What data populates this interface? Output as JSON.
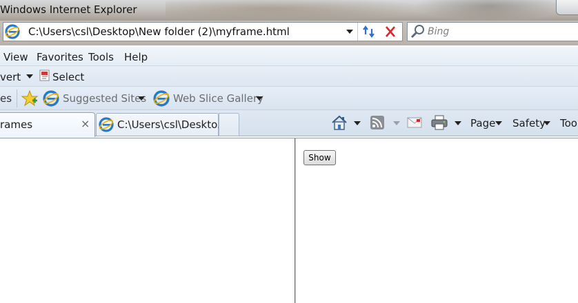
{
  "window": {
    "title": "Windows Internet Explorer"
  },
  "address_bar": {
    "url": "C:\\Users\\csl\\Desktop\\New folder (2)\\myframe.html",
    "search_placeholder": "Bing"
  },
  "menu_bar": {
    "items": [
      "View",
      "Favorites",
      "Tools",
      "Help"
    ]
  },
  "command_row": {
    "convert_label": "vert",
    "select_label": "Select"
  },
  "favorites_bar": {
    "cut_label": "es",
    "suggested_sites": "Suggested Sites",
    "web_slice_gallery": "Web Slice Gallery"
  },
  "tabs": {
    "active_label": "rames",
    "close_glyph": "×",
    "second_label": "C:\\Users\\csl\\Deskto..."
  },
  "command_bar": {
    "page": "Page",
    "safety": "Safety",
    "tools": "Too"
  },
  "content": {
    "show_button": "Show"
  },
  "colors": {
    "toolbar_blue": "#dfe8f3",
    "stop_red": "#d9262b",
    "refresh_blue": "#2c6fd1"
  }
}
